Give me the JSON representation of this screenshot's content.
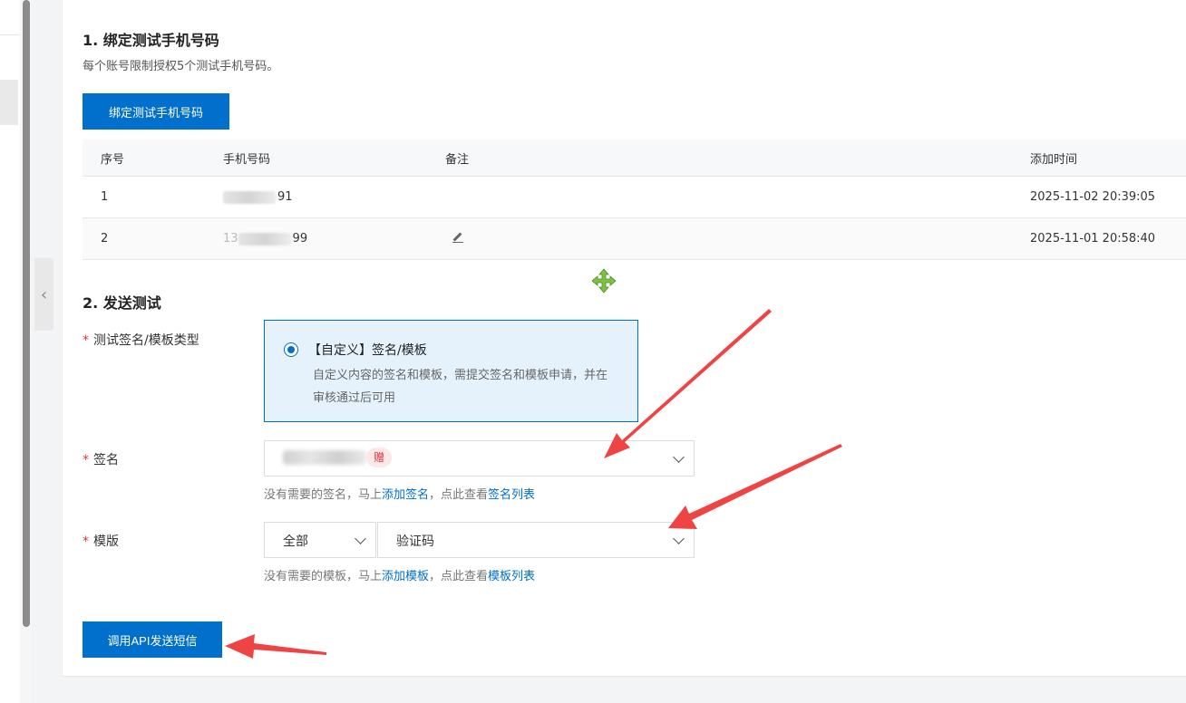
{
  "section1": {
    "title": "1. 绑定测试手机号码",
    "desc": "每个账号限制授权5个测试手机号码。",
    "bind_button": "绑定测试手机号码"
  },
  "table": {
    "headers": [
      "序号",
      "手机号码",
      "备注",
      "添加时间"
    ],
    "rows": [
      {
        "index": "1",
        "phone_suffix": "91",
        "note": "",
        "time": "2025-11-02 20:39:05"
      },
      {
        "index": "2",
        "phone_prefix": "13",
        "phone_suffix": "99",
        "note": "",
        "time": "2025-11-01 20:58:40"
      }
    ]
  },
  "section2": {
    "title": "2. 发送测试",
    "type_label": "测试签名/模板类型",
    "radio_title": "【自定义】签名/模板",
    "radio_desc": "自定义内容的签名和模板，需提交签名和模板申请，并在审核通过后可用",
    "sign_label": "签名",
    "sign_tag": "赠",
    "sign_hint_pre": "没有需要的签名，马上",
    "sign_hint_add": "添加签名",
    "sign_hint_mid": "，点此查看",
    "sign_hint_list": "签名列表",
    "tpl_label": "模版",
    "tpl_category": "全部",
    "tpl_value": "验证码",
    "tpl_hint_pre": "没有需要的模板，马上",
    "tpl_hint_add": "添加模板",
    "tpl_hint_mid": "，点此查看",
    "tpl_hint_list": "模板列表",
    "send_button": "调用API发送短信"
  },
  "colors": {
    "primary": "#0070cc",
    "required": "#d9363e",
    "annotation_arrow": "#ee4444"
  }
}
